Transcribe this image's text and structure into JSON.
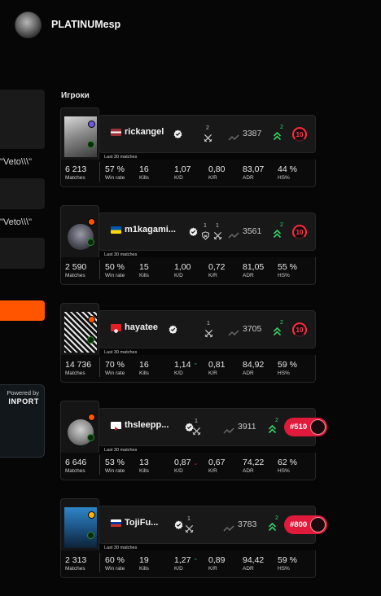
{
  "header": {
    "username": "PLATINUMesp"
  },
  "left_panel": {
    "veto_text_1": "\"Veto\\\\\\\"",
    "veto_text_2": "\"Veto\\\\\\\"",
    "powered_by": "Powered by",
    "brand": "INPORT"
  },
  "section": {
    "title": "Игроки"
  },
  "labels": {
    "last_matches": "Last 30 matches",
    "matches": "Matches",
    "win_rate": "Win rate",
    "kills": "Kills",
    "kd": "K/D",
    "kr": "K/R",
    "adr": "ADR",
    "hs": "HS%"
  },
  "colors": {
    "accent_orange": "#ff5500",
    "rank_red": "#e01a3a",
    "trend_green": "#35d06a"
  },
  "players": [
    {
      "name": "rickangel",
      "flag": "latvia",
      "party_count": "2",
      "elo": "3387",
      "elo_gain": "2",
      "level": "10",
      "rank": "",
      "matches": "6 213",
      "win_rate": "57 %",
      "kills": "16",
      "kd": "1,07",
      "kd_trend": "",
      "kr": "0,80",
      "adr": "83,07",
      "hs": "44 %"
    },
    {
      "name": "m1kagami...",
      "flag": "ukraine",
      "party_count": "1",
      "party_count_2": "1",
      "elo": "3561",
      "elo_gain": "2",
      "level": "10",
      "rank": "",
      "matches": "2 590",
      "win_rate": "50 %",
      "kills": "15",
      "kd": "1,00",
      "kd_trend": "",
      "kr": "0,72",
      "adr": "81,05",
      "hs": "55 %"
    },
    {
      "name": "hayatee",
      "flag": "switzerland",
      "party_count": "1",
      "elo": "3705",
      "elo_gain": "2",
      "level": "10",
      "rank": "",
      "matches": "14 736",
      "win_rate": "70 %",
      "kills": "16",
      "kd": "1,14",
      "kd_trend": "up",
      "kr": "0,81",
      "adr": "84,92",
      "hs": "59 %"
    },
    {
      "name": "thsleepp...",
      "flag": "youtube",
      "party_count": "1",
      "elo": "3911",
      "elo_gain": "2",
      "level": "",
      "rank": "#510",
      "matches": "6 646",
      "win_rate": "53 %",
      "kills": "13",
      "kd": "0,87",
      "kd_trend": "down",
      "kr": "0,67",
      "adr": "74,22",
      "hs": "62 %"
    },
    {
      "name": "TojiFu...",
      "flag": "russia",
      "party_count": "1",
      "elo": "3783",
      "elo_gain": "2",
      "level": "",
      "rank": "#800",
      "matches": "2 313",
      "win_rate": "60 %",
      "kills": "19",
      "kd": "1,27",
      "kd_trend": "up",
      "kr": "0,89",
      "adr": "94,42",
      "hs": "59 %"
    }
  ]
}
